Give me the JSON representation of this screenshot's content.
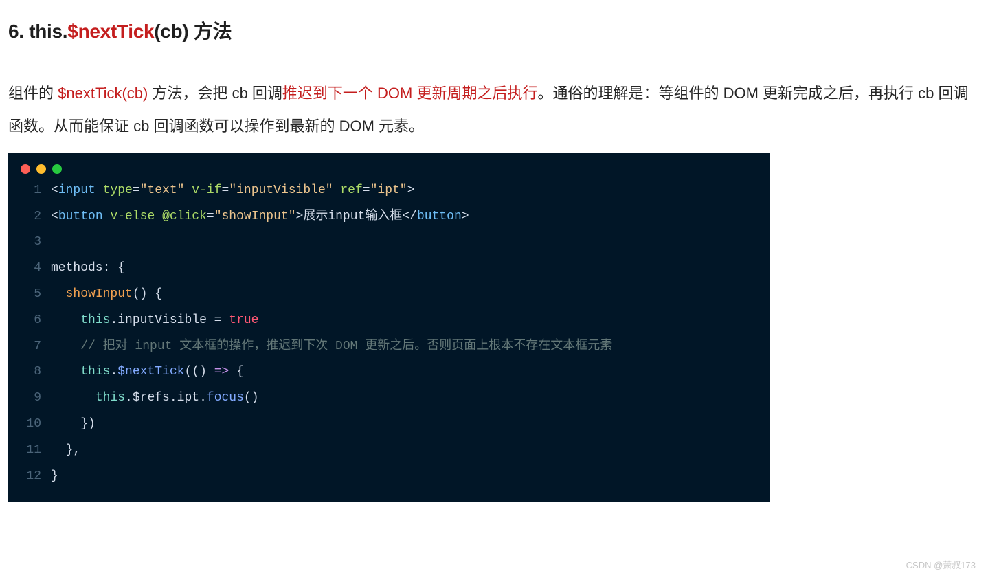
{
  "heading": {
    "prefix": "6. this.",
    "highlight": "$nextTick",
    "suffix": "(cb) 方法"
  },
  "paragraph": {
    "seg1": "组件的 ",
    "seg2_red": "$nextTick(cb)",
    "seg3": " 方法，会把 cb 回调",
    "seg4_red": "推迟到下一个 DOM 更新周期之后执行",
    "seg5": "。通俗的理解是：等组件的 DOM 更新完成之后，再执行 cb 回调函数。从而能保证 cb 回调函数可以操作到最新的 DOM 元素。"
  },
  "code": {
    "lines": [
      {
        "n": "1",
        "tokens": [
          {
            "c": "tok-punct",
            "t": "<"
          },
          {
            "c": "tok-tag",
            "t": "input"
          },
          {
            "c": "tok-default",
            "t": " "
          },
          {
            "c": "tok-attr",
            "t": "type"
          },
          {
            "c": "tok-punct",
            "t": "="
          },
          {
            "c": "tok-string",
            "t": "\"text\""
          },
          {
            "c": "tok-default",
            "t": " "
          },
          {
            "c": "tok-attr",
            "t": "v-if"
          },
          {
            "c": "tok-punct",
            "t": "="
          },
          {
            "c": "tok-string",
            "t": "\"inputVisible\""
          },
          {
            "c": "tok-default",
            "t": " "
          },
          {
            "c": "tok-attr",
            "t": "ref"
          },
          {
            "c": "tok-punct",
            "t": "="
          },
          {
            "c": "tok-string",
            "t": "\"ipt\""
          },
          {
            "c": "tok-punct",
            "t": ">"
          }
        ]
      },
      {
        "n": "2",
        "tokens": [
          {
            "c": "tok-punct",
            "t": "<"
          },
          {
            "c": "tok-tag",
            "t": "button"
          },
          {
            "c": "tok-default",
            "t": " "
          },
          {
            "c": "tok-attr",
            "t": "v-else"
          },
          {
            "c": "tok-default",
            "t": " "
          },
          {
            "c": "tok-attr",
            "t": "@click"
          },
          {
            "c": "tok-punct",
            "t": "="
          },
          {
            "c": "tok-string",
            "t": "\"showInput\""
          },
          {
            "c": "tok-punct",
            "t": ">"
          },
          {
            "c": "tok-text",
            "t": "展示input输入框"
          },
          {
            "c": "tok-punct",
            "t": "</"
          },
          {
            "c": "tok-tag",
            "t": "button"
          },
          {
            "c": "tok-punct",
            "t": ">"
          }
        ]
      },
      {
        "n": "3",
        "tokens": []
      },
      {
        "n": "4",
        "tokens": [
          {
            "c": "tok-default",
            "t": "methods"
          },
          {
            "c": "tok-punct",
            "t": ": {"
          }
        ]
      },
      {
        "n": "5",
        "tokens": [
          {
            "c": "tok-default",
            "t": "  "
          },
          {
            "c": "tok-method-accent",
            "t": "showInput"
          },
          {
            "c": "tok-punct",
            "t": "() {"
          }
        ]
      },
      {
        "n": "6",
        "tokens": [
          {
            "c": "tok-default",
            "t": "    "
          },
          {
            "c": "tok-this",
            "t": "this"
          },
          {
            "c": "tok-punct",
            "t": "."
          },
          {
            "c": "tok-default",
            "t": "inputVisible"
          },
          {
            "c": "tok-punct",
            "t": " = "
          },
          {
            "c": "tok-bool",
            "t": "true"
          }
        ]
      },
      {
        "n": "7",
        "tokens": [
          {
            "c": "tok-default",
            "t": "    "
          },
          {
            "c": "tok-comment",
            "t": "// 把对 input 文本框的操作，推迟到下次 DOM 更新之后。否则页面上根本不存在文本框元素"
          }
        ]
      },
      {
        "n": "8",
        "tokens": [
          {
            "c": "tok-default",
            "t": "    "
          },
          {
            "c": "tok-this",
            "t": "this"
          },
          {
            "c": "tok-punct",
            "t": "."
          },
          {
            "c": "tok-method",
            "t": "$nextTick"
          },
          {
            "c": "tok-punct",
            "t": "(() "
          },
          {
            "c": "tok-keyword",
            "t": "=>"
          },
          {
            "c": "tok-punct",
            "t": " {"
          }
        ]
      },
      {
        "n": "9",
        "tokens": [
          {
            "c": "tok-default",
            "t": "      "
          },
          {
            "c": "tok-this",
            "t": "this"
          },
          {
            "c": "tok-punct",
            "t": "."
          },
          {
            "c": "tok-default",
            "t": "$refs"
          },
          {
            "c": "tok-punct",
            "t": "."
          },
          {
            "c": "tok-default",
            "t": "ipt"
          },
          {
            "c": "tok-punct",
            "t": "."
          },
          {
            "c": "tok-method",
            "t": "focus"
          },
          {
            "c": "tok-punct",
            "t": "()"
          }
        ]
      },
      {
        "n": "10",
        "tokens": [
          {
            "c": "tok-default",
            "t": "    "
          },
          {
            "c": "tok-punct",
            "t": "})"
          }
        ]
      },
      {
        "n": "11",
        "tokens": [
          {
            "c": "tok-default",
            "t": "  "
          },
          {
            "c": "tok-punct",
            "t": "},"
          }
        ]
      },
      {
        "n": "12",
        "tokens": [
          {
            "c": "tok-punct",
            "t": "}"
          }
        ]
      }
    ]
  },
  "watermark": "CSDN @萧叔173"
}
